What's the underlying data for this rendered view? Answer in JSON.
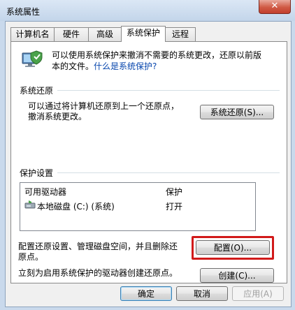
{
  "window": {
    "title": "系统属性",
    "close_glyph": "✕"
  },
  "tabs": [
    {
      "label": "计算机名"
    },
    {
      "label": "硬件"
    },
    {
      "label": "高级"
    },
    {
      "label": "系统保护"
    },
    {
      "label": "远程"
    }
  ],
  "intro": {
    "text_line1": "可以使用系统保护来撤消不需要的系统更改，还原以前版",
    "text_line2_prefix": "本的文件。",
    "link": "什么是系统保护?"
  },
  "restore": {
    "section": "系统还原",
    "line1": "可以通过将计算机还原到上一个还原点，",
    "line2": "撤消系统更改。",
    "button": "系统还原(S)..."
  },
  "protection": {
    "section": "保护设置",
    "col_drive": "可用驱动器",
    "col_protection": "保护",
    "rows": [
      {
        "drive": "本地磁盘 (C:) (系统)",
        "status": "打开"
      }
    ],
    "configure_line1": "配置还原设置、管理磁盘空间，并且删除还",
    "configure_line2": "原点。",
    "configure_button": "配置(O)...",
    "create_text": "立刻为启用系统保护的驱动器创建还原点。",
    "create_button": "创建(C)..."
  },
  "footer": {
    "ok": "确定",
    "cancel": "取消",
    "apply": "应用(A)"
  },
  "colors": {
    "highlight": "#d11a1a",
    "link": "#0645ad"
  }
}
